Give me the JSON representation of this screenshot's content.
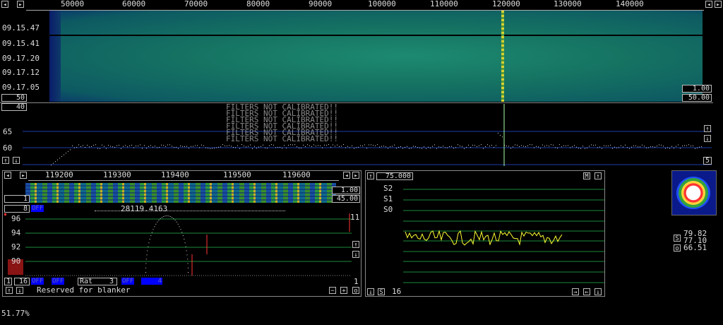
{
  "top_ruler": {
    "ticks": [
      "50000",
      "60000",
      "70000",
      "80000",
      "90000",
      "100000",
      "110000",
      "120000",
      "130000",
      "140000"
    ]
  },
  "waterfall": {
    "timestamps": [
      "09.15.47",
      "09.15.41",
      "09.17.20",
      "09.17.12",
      "09.17.05"
    ],
    "left_box": "50",
    "right_box_top": "1.00",
    "right_box_bottom": "50.00"
  },
  "spectrum": {
    "top_left_box": "40",
    "warning_lines": [
      "FILTERS NOT CALIBRATED!!",
      "FILTERS NOT CALIBRATED!!",
      "FILTERS NOT CALIBRATED!!",
      "FILTERS NOT CALIBRATED!!",
      "FILTERS NOT CALIBRATED!!",
      "FILTERS NOT CALIBRATED!!"
    ],
    "y_labels": [
      "65",
      "60"
    ],
    "right_box": "5"
  },
  "lower_left": {
    "ruler_ticks": [
      "119200",
      "119300",
      "119400",
      "119500",
      "119600"
    ],
    "box_top_left": "1",
    "box_right_top": "1.00",
    "box_right_bottom": "45.00",
    "count": "8",
    "off": "OFF",
    "frequency": "28119.4163",
    "y_labels": [
      "96",
      "94",
      "92",
      "90"
    ],
    "right_val": "11",
    "bottom_right_val": "1",
    "ctrl_num": "16",
    "off2": "OFF",
    "off3": "OFF",
    "rat_label": "Rat",
    "rat_val": "3",
    "off4": "OFF",
    "off4_val": "4",
    "status": "Reserved for blanker",
    "marker_minus": "−",
    "marker_plus": "+",
    "marker_o": "o"
  },
  "smeter": {
    "top_box": "75.000",
    "m_btn": "M",
    "labels": [
      "S2",
      "S1",
      "S0"
    ],
    "s_btn": "S",
    "s_val": "16"
  },
  "right_panel": {
    "s_btn": "S",
    "o_btn": "o",
    "values": [
      "79.82",
      "77.10",
      "66.51"
    ]
  },
  "footer": {
    "percent": "51.77%"
  },
  "colors": {
    "grid": "#1e3caa",
    "green_line": "#1b8a3a",
    "trace": "#ffff33",
    "marker": "#ff3333"
  }
}
